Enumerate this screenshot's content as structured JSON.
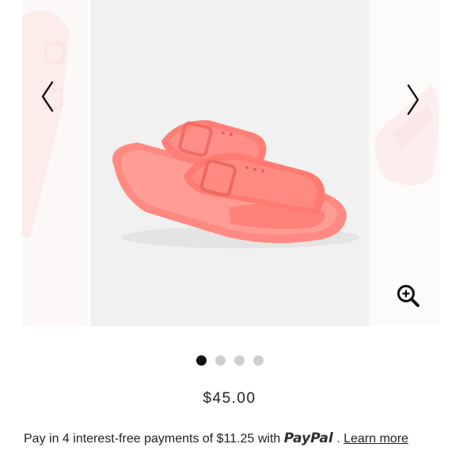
{
  "gallery": {
    "product_image": "pink-two-strap-slide-sandal",
    "prev_icon": "chevron-left-icon",
    "next_icon": "chevron-right-icon",
    "zoom_icon": "zoom-in-icon",
    "slide_count": 4,
    "active_slide": 1
  },
  "product": {
    "price": "$45.00"
  },
  "paypal": {
    "text_before": "Pay in 4 interest-free payments of $11.25 with",
    "logo_pay": "Pay",
    "logo_pal": "Pal",
    "separator": ".",
    "learn_more": "Learn more"
  },
  "colors": {
    "sandal": "#ff8d85",
    "dot_active": "#111111",
    "dot_inactive": "#cfcfcf"
  }
}
